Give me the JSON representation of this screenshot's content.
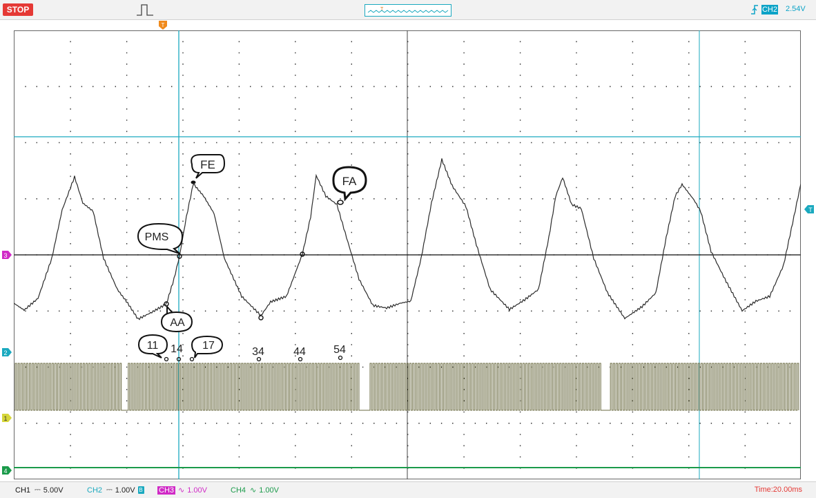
{
  "topbar": {
    "run_state": "STOP",
    "trigger_marker": "T",
    "trigger_channel": "CH2",
    "trigger_level": "2.54V"
  },
  "side_markers": {
    "ch3": "3",
    "ch2": "2",
    "ch1": "1",
    "ch4": "4",
    "trigger": "T"
  },
  "annotations": {
    "fe": "FE",
    "fa": "FA",
    "pms": "PMS",
    "aa": "AA",
    "t11": "11",
    "t14": "14",
    "t17": "17",
    "t34": "34",
    "t44": "44",
    "t54": "54"
  },
  "channels": {
    "ch1": {
      "name": "CH1",
      "coupling": "⎓",
      "scale": "5.00V",
      "color": "#b3b34a"
    },
    "ch2": {
      "name": "CH2",
      "coupling": "⎓",
      "scale": "1.00V",
      "bw": "B",
      "color": "#1aa9bf"
    },
    "ch3": {
      "name": "CH3",
      "coupling": "∿",
      "scale": "1.00V",
      "color": "#d02ac6"
    },
    "ch4": {
      "name": "CH4",
      "coupling": "∿",
      "scale": "1.00V",
      "color": "#1a9a4a"
    }
  },
  "timebase": "Time:20.00ms",
  "colors": {
    "signal_ch3": "#2a2a2a",
    "square_ch1": "#6a6a40",
    "cursor": "#1aa9bf",
    "grid_dots": "#333333"
  }
}
